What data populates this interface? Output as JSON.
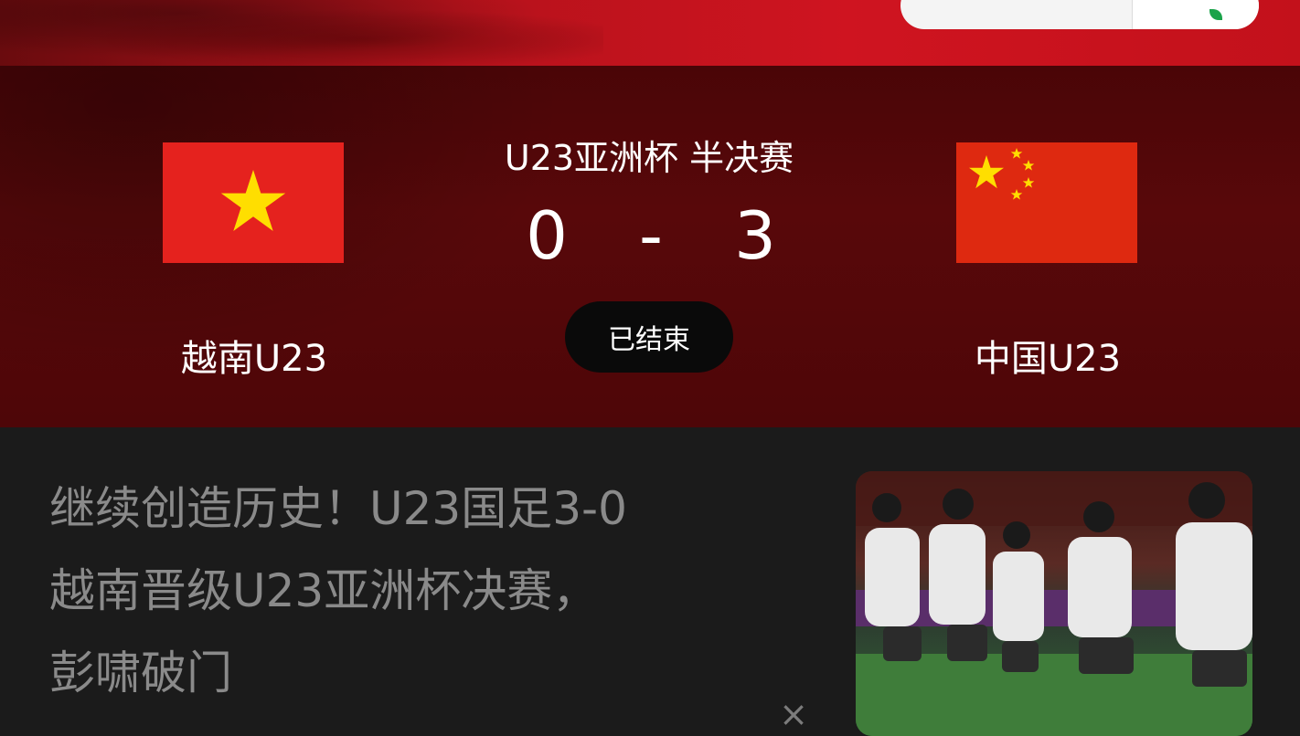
{
  "match": {
    "competition": "U23亚洲杯 半决赛",
    "home_team": "越南U23",
    "away_team": "中国U23",
    "home_score": "0",
    "separator": "-",
    "away_score": "3",
    "status": "已结束"
  },
  "news": {
    "title_lines": [
      "继续创造历史！U23国足3-0",
      "越南晋级U23亚洲杯决赛，",
      "彭啸破门"
    ],
    "dismiss_symbol": "×"
  },
  "colors": {
    "hero_red": "#cf1420",
    "panel_dark_red": "#58080a",
    "flag_red": "#de2910",
    "star_yellow": "#ffde00",
    "background": "#1b1b1b",
    "news_text": "#8a8a8a",
    "status_pill": "#0a0a0a"
  },
  "icons": {
    "home_flag": "vietnam-flag-icon",
    "away_flag": "china-flag-icon",
    "dismiss": "close-icon"
  }
}
